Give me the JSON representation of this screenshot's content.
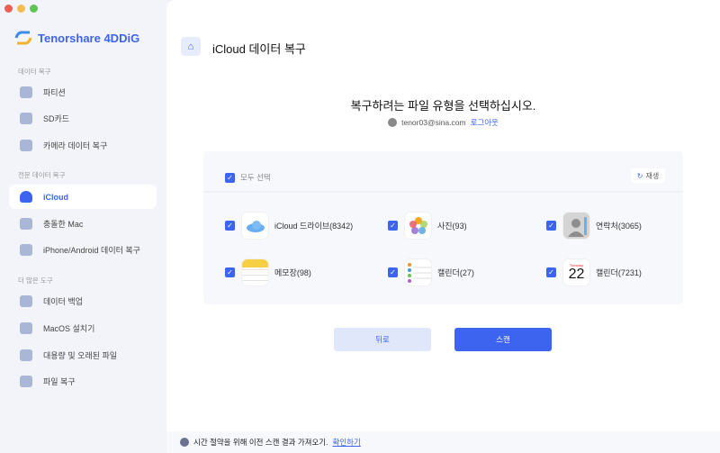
{
  "colors": {
    "accent": "#3d64ee",
    "sidebar_bg": "#f3f4f9"
  },
  "app": {
    "name": "Tenorshare 4DDiG"
  },
  "sidebar": {
    "sections": [
      {
        "label": "데이터 복구",
        "items": [
          {
            "label": "파티션",
            "icon": "drive-icon"
          },
          {
            "label": "SD카드",
            "icon": "sd-card-icon"
          },
          {
            "label": "카메라 데이터 복구",
            "icon": "camera-icon"
          }
        ]
      },
      {
        "label": "전문 데이터 복구",
        "items": [
          {
            "label": "iCloud",
            "icon": "cloud-icon",
            "active": true
          },
          {
            "label": "충돌한 Mac",
            "icon": "mac-icon"
          },
          {
            "label": "iPhone/Android 데이터 복구",
            "icon": "phone-icon"
          }
        ]
      },
      {
        "label": "더 많은 도구",
        "items": [
          {
            "label": "데이터 백업",
            "icon": "backup-icon"
          },
          {
            "label": "MacOS 설치기",
            "icon": "apple-icon"
          },
          {
            "label": "대용량 및 오래된 파일",
            "icon": "file-icon"
          },
          {
            "label": "파일 복구",
            "icon": "repair-icon"
          }
        ]
      }
    ]
  },
  "header": {
    "title": "iCloud 데이터 복구"
  },
  "main": {
    "heading": "복구하려는 파일 유형을 선택하십시오.",
    "account": "tenor03@sina.com",
    "logout": "로그아웃",
    "select_all": "모두 선택",
    "refresh": "재생",
    "file_types": [
      {
        "label": "iCloud 드라이브(8342)",
        "checked": true
      },
      {
        "label": "사진(93)",
        "checked": true
      },
      {
        "label": "연락처(3065)",
        "checked": true
      },
      {
        "label": "메모장(98)",
        "checked": true
      },
      {
        "label": "캘린더(27)",
        "checked": true
      },
      {
        "label": "캘린더(7231)",
        "checked": true
      }
    ],
    "calendar_day": "Tuesday",
    "calendar_date": "22",
    "back": "뒤로",
    "scan": "스캔"
  },
  "footer": {
    "text": "시간 절약을 위해 이전 스캔 결과 가져오기.",
    "link": "확인하기"
  }
}
